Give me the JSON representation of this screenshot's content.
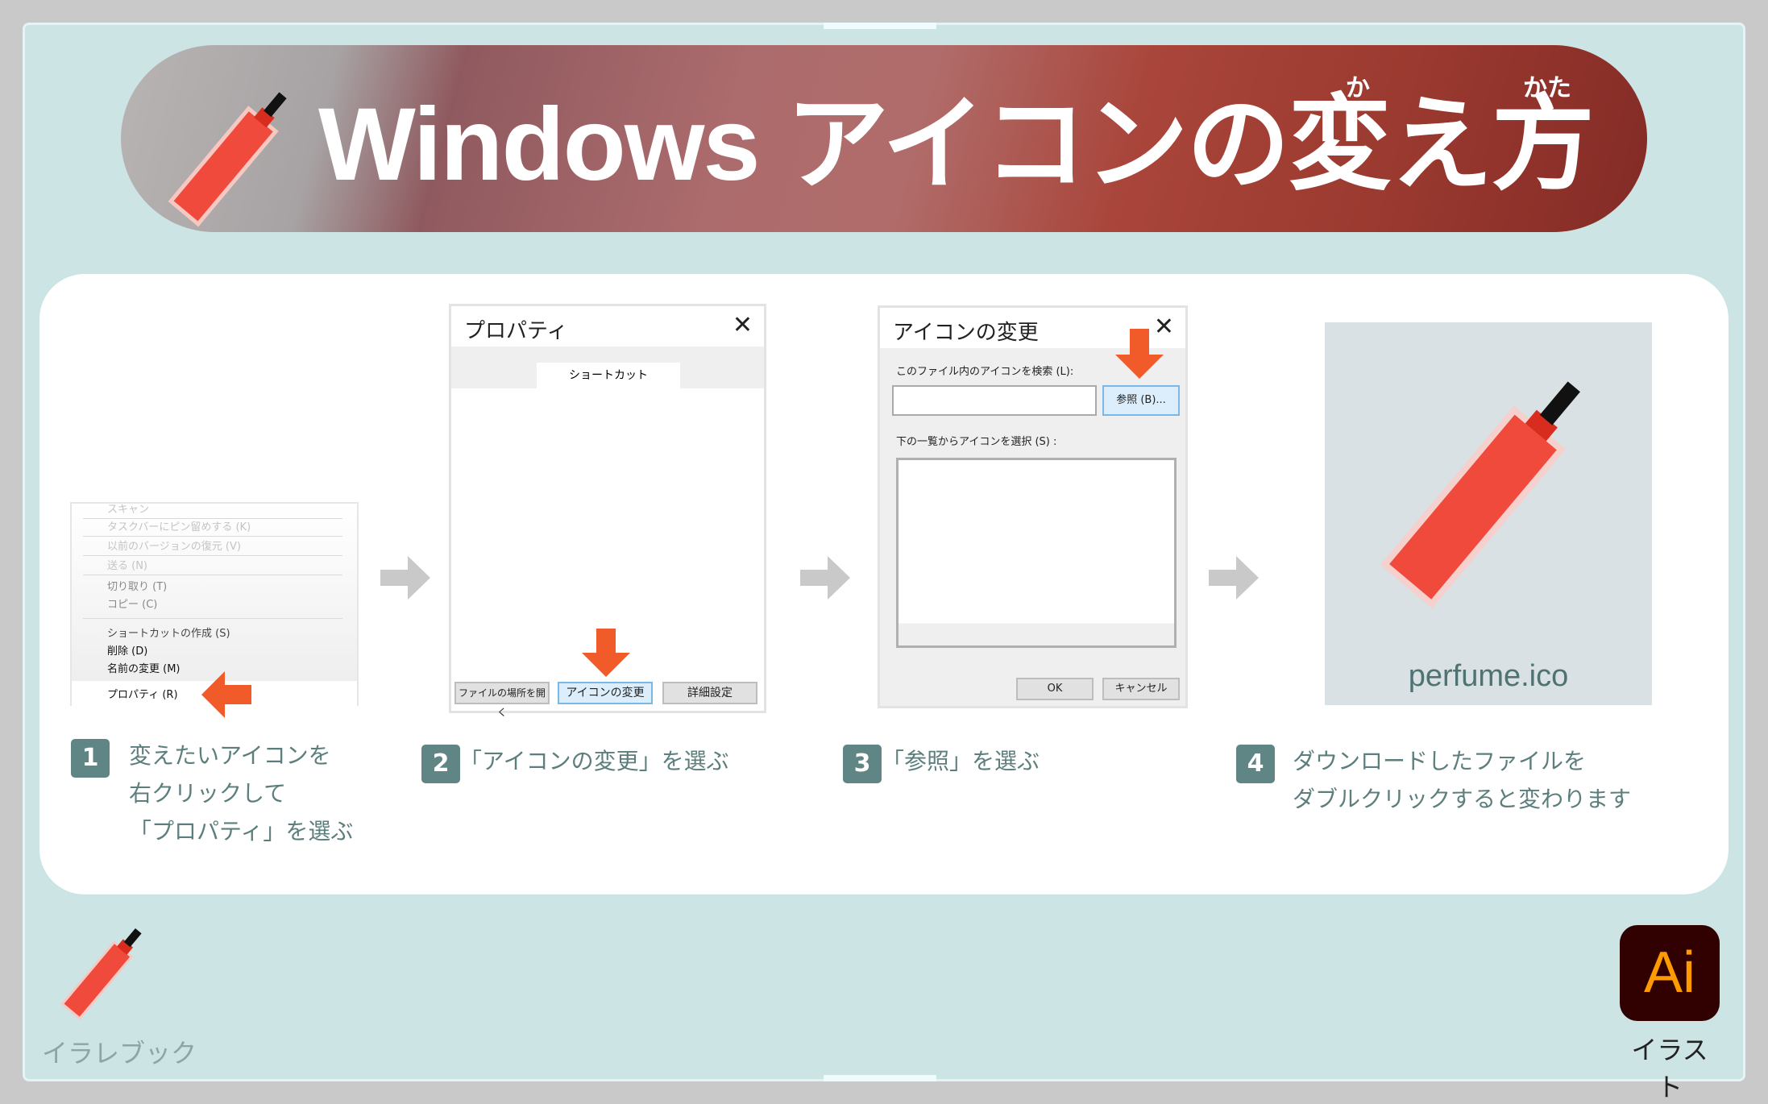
{
  "header": {
    "title": "Windows アイコンの変え方",
    "ruby_ka": "か",
    "ruby_kata": "かた"
  },
  "context_menu": {
    "items": [
      "スキャン",
      "タスクバーにピン留めする (K)",
      "以前のバージョンの復元 (V)",
      "送る (N)",
      "切り取り (T)",
      "コピー (C)",
      "ショートカットの作成 (S)",
      "削除 (D)",
      "名前の変更 (M)",
      "プロパティ (R)"
    ]
  },
  "properties_dialog": {
    "title": "プロパティ",
    "tab": "ショートカット",
    "buttons": [
      "ファイルの場所を開く",
      "アイコンの変更",
      "詳細設定"
    ]
  },
  "icon_dialog": {
    "title": "アイコンの変更",
    "search_label": "このファイル内のアイコンを検索 (L):",
    "search_value": "",
    "browse": "参照 (B)...",
    "list_label": "下の一覧からアイコンを選択 (S) :",
    "ok": "OK",
    "cancel": "キャンセル"
  },
  "preview": {
    "filename": "perfume.ico"
  },
  "steps": [
    {
      "num": "1",
      "lines": [
        "変えたいアイコンを",
        "右クリックして",
        "「プロパティ」を選ぶ"
      ]
    },
    {
      "num": "2",
      "text": "「アイコンの変更」を選ぶ"
    },
    {
      "num": "3",
      "text": "「参照」を選ぶ"
    },
    {
      "num": "4",
      "lines": [
        "ダウンロードしたファイルを",
        "ダブルクリックすると変わります"
      ]
    }
  ],
  "footer": {
    "brand": "イラレブック",
    "ai_logo": "Ai",
    "ai_label": "イラスト"
  },
  "colors": {
    "accent_arrow": "#f15a29",
    "step_text": "#5c7f7e",
    "background": "#cde4e5"
  }
}
